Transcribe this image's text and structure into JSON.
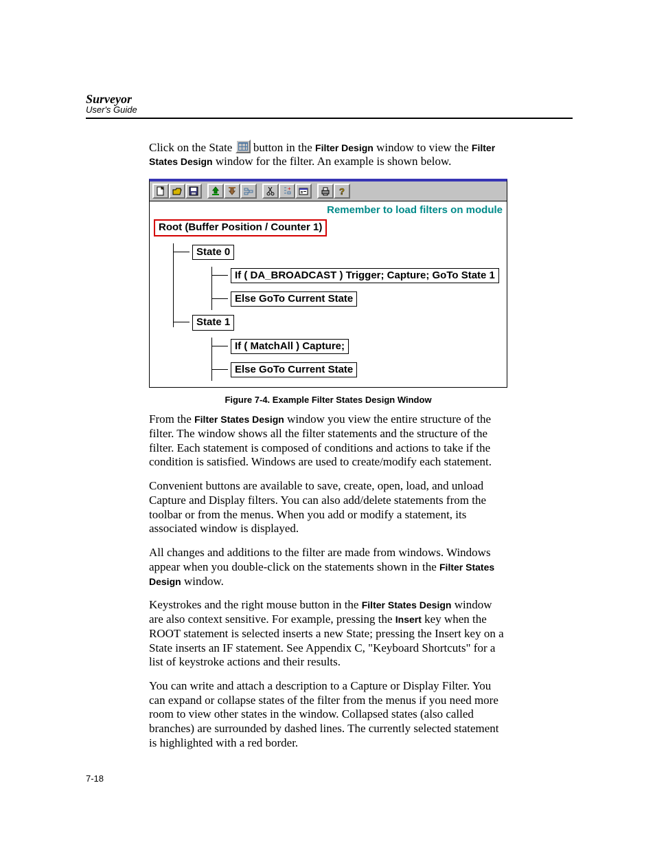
{
  "header": {
    "title": "Surveyor",
    "subtitle": "User's Guide"
  },
  "intro": {
    "t1": "Click on the State ",
    "t2": " button in the ",
    "b1": "Filter Design",
    "t3": " window to view the ",
    "b2": "Filter States Design",
    "t4": " window for the filter. An example is shown below."
  },
  "shot": {
    "toolbar_icons": [
      "new",
      "open",
      "save",
      "load",
      "unload",
      "state",
      "cut",
      "paste",
      "prop",
      "print",
      "help"
    ],
    "reminder": "Remember to load filters on module",
    "root": "Root (Buffer Position / Counter 1)",
    "state0": {
      "label": "State 0",
      "if": "If ( DA_BROADCAST )  Trigger;  Capture; GoTo State 1",
      "else": "Else GoTo Current State"
    },
    "state1": {
      "label": "State 1",
      "if": "If ( MatchAll )  Capture;",
      "else": "Else GoTo Current State"
    }
  },
  "caption": "Figure 7-4.  Example Filter States Design Window",
  "paras": {
    "p1a": "From the ",
    "p1b": "Filter States Design",
    "p1c": " window you view the entire structure of the filter. The window shows all the filter statements and the structure of the filter. Each statement is composed of conditions and actions to take if the condition is satisfied. Windows are used to create/modify each statement.",
    "p2": "Convenient buttons are available to save, create, open, load, and unload Capture and Display filters. You can also add/delete statements from the toolbar or from the menus. When you add or modify a statement, its associated window is displayed.",
    "p3a": "All changes and additions to the filter are made from windows. Windows appear when you double-click on the statements shown in the ",
    "p3b": "Filter States Design",
    "p3c": " window.",
    "p4a": "Keystrokes and the right mouse button in the ",
    "p4b": "Filter States Design",
    "p4c": " window are also context sensitive. For example, pressing the ",
    "p4d": "Insert",
    "p4e": " key when the ROOT statement is selected inserts a new State; pressing the Insert key on a State inserts an IF statement. See Appendix C, \"Keyboard Shortcuts\" for a list of keystroke actions and their results.",
    "p5": "You can write and attach a description to a Capture or Display Filter. You can expand or collapse states of the filter from the menus if you need more room to view other states in the window. Collapsed states (also called branches) are surrounded by dashed lines. The currently selected statement is highlighted with a red border."
  },
  "pagenum": "7-18"
}
